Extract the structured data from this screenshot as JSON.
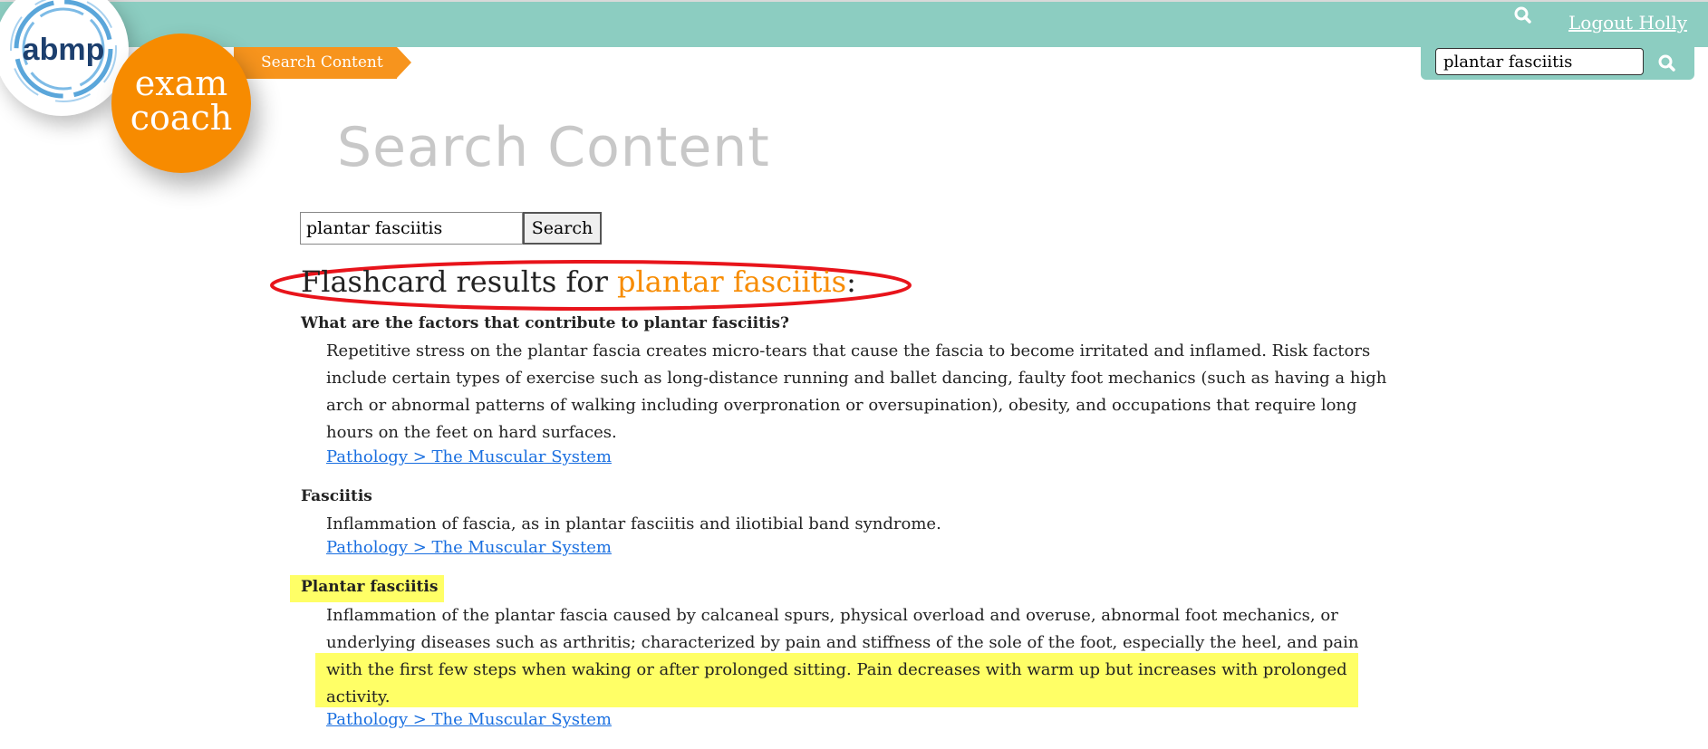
{
  "header": {
    "logo_abmp": "abmp",
    "logo_exam_coach": [
      "exam",
      "coach"
    ],
    "search_icon": "search-icon",
    "logout_label": "Logout Holly",
    "search_value": "plantar fasciitis",
    "breadcrumb": "Search Content",
    "colors": {
      "teal": "#8ccdc1",
      "orange": "#f78b00"
    }
  },
  "page": {
    "title": "Search Content",
    "search_value": "plantar fasciitis",
    "search_button": "Search",
    "results_prefix": "Flashcard results for ",
    "results_term": "plantar fasciitis",
    "results_suffix": ":"
  },
  "results": [
    {
      "term": "What are the factors that contribute to plantar fasciitis?",
      "definition": "Repetitive stress on the plantar fascia creates micro-tears that cause the fascia to become irritated and inflamed. Risk factors include certain types of exercise such as long-distance running and ballet dancing, faulty foot mechanics (such as having a high arch or abnormal patterns of walking including overpronation or oversupination), obesity, and occupations that require long hours on the feet on hard surfaces.",
      "link": "Pathology > The Muscular System"
    },
    {
      "term": "Fasciitis",
      "definition": "Inflammation of fascia, as in plantar fasciitis and iliotibial band syndrome.",
      "link": "Pathology > The Muscular System"
    },
    {
      "term": "Plantar fasciitis",
      "definition": "Inflammation of the plantar fascia caused by calcaneal spurs, physical overload and overuse, abnormal foot mechanics, or underlying diseases such as arthritis; characterized by pain and stiffness of the sole of the foot, especially the heel, and pain with the first few steps when waking or after prolonged sitting. Pain decreases with warm up but increases with prolonged activity.",
      "link": "Pathology > The Muscular System"
    }
  ]
}
